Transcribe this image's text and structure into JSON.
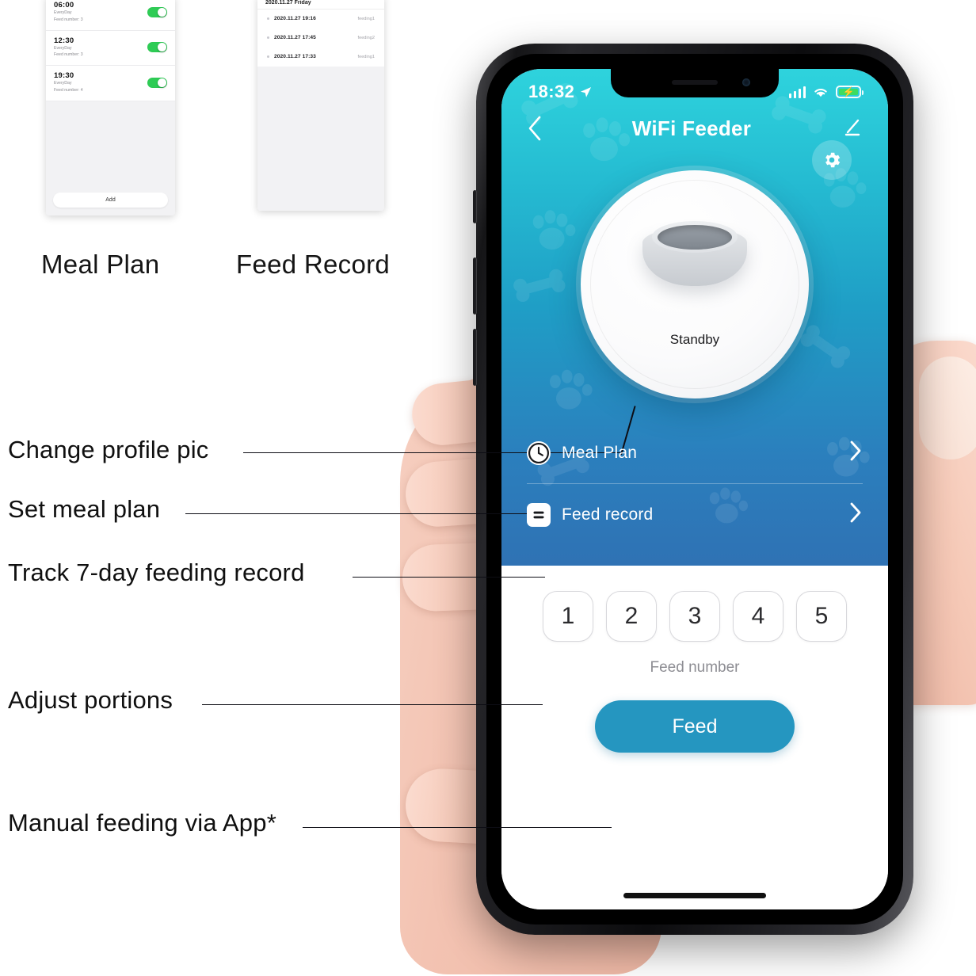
{
  "thumbnails": [
    {
      "caption": "Meal Plan",
      "screen": "meal-plan",
      "rows": [
        {
          "time": "06:00",
          "repeat": "EveryDay",
          "feed": "Feed number: 3",
          "enabled": true
        },
        {
          "time": "12:30",
          "repeat": "EveryDay",
          "feed": "Feed number: 3",
          "enabled": true
        },
        {
          "time": "19:30",
          "repeat": "EveryDay",
          "feed": "Feed number: 4",
          "enabled": true
        }
      ],
      "add_label": "Add"
    },
    {
      "caption": "Feed Record",
      "screen": "feed-record",
      "header": "2020.11.27 Friday",
      "rows": [
        {
          "time": "2020.11.27 19:16",
          "tag": "feeding1"
        },
        {
          "time": "2020.11.27 17:45",
          "tag": "feeding2"
        },
        {
          "time": "2020.11.27 17:33",
          "tag": "feeding1"
        }
      ]
    }
  ],
  "annotations": [
    {
      "id": "change-profile-pic",
      "text": "Change profile pic"
    },
    {
      "id": "set-meal-plan",
      "text": "Set meal plan"
    },
    {
      "id": "track-feeding-record",
      "text": "Track 7-day feeding record"
    },
    {
      "id": "adjust-portions",
      "text": "Adjust portions"
    },
    {
      "id": "manual-feeding",
      "text": "Manual feeding via App*"
    }
  ],
  "phone": {
    "statusbar": {
      "time": "18:32",
      "location_icon": "location-arrow-icon",
      "signal_icon": "signal-bars-icon",
      "wifi_icon": "wifi-icon",
      "battery_icon": "battery-charging-icon"
    },
    "navbar": {
      "back_icon": "chevron-left-icon",
      "title": "WiFi Feeder",
      "edit_icon": "pencil-edit-icon"
    },
    "settings_icon": "gear-icon",
    "device": {
      "status": "Standby",
      "image": "pet-feeder-bowl"
    },
    "menu": [
      {
        "label": "Meal Plan",
        "icon": "clock-icon",
        "chevron": "chevron-right-icon"
      },
      {
        "label": "Feed record",
        "icon": "record-list-icon",
        "chevron": "chevron-right-icon"
      }
    ],
    "portions": {
      "options": [
        "1",
        "2",
        "3",
        "4",
        "5"
      ],
      "label": "Feed number"
    },
    "feed_button": "Feed"
  },
  "colors": {
    "gradient_top": "#2ed3dd",
    "gradient_bottom": "#2f72b4",
    "feed_button": "#2596c0",
    "toggle_on": "#2ecc55",
    "battery": "#3ddc60"
  }
}
